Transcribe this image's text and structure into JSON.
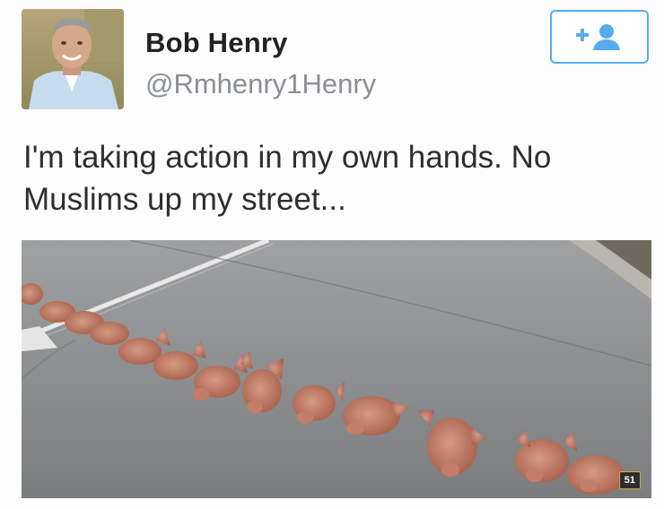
{
  "user": {
    "display_name": "Bob Henry",
    "handle": "@Rmhenry1Henry"
  },
  "follow_button": {
    "icon": "add-user-icon",
    "label": "+"
  },
  "tweet": {
    "text_line1": "I'm taking action in my own hands. No",
    "text_line2": "Muslims up my street..."
  },
  "media": {
    "badge": "51"
  },
  "colors": {
    "accent": "#55acee",
    "handle_gray": "#8a8f95"
  }
}
